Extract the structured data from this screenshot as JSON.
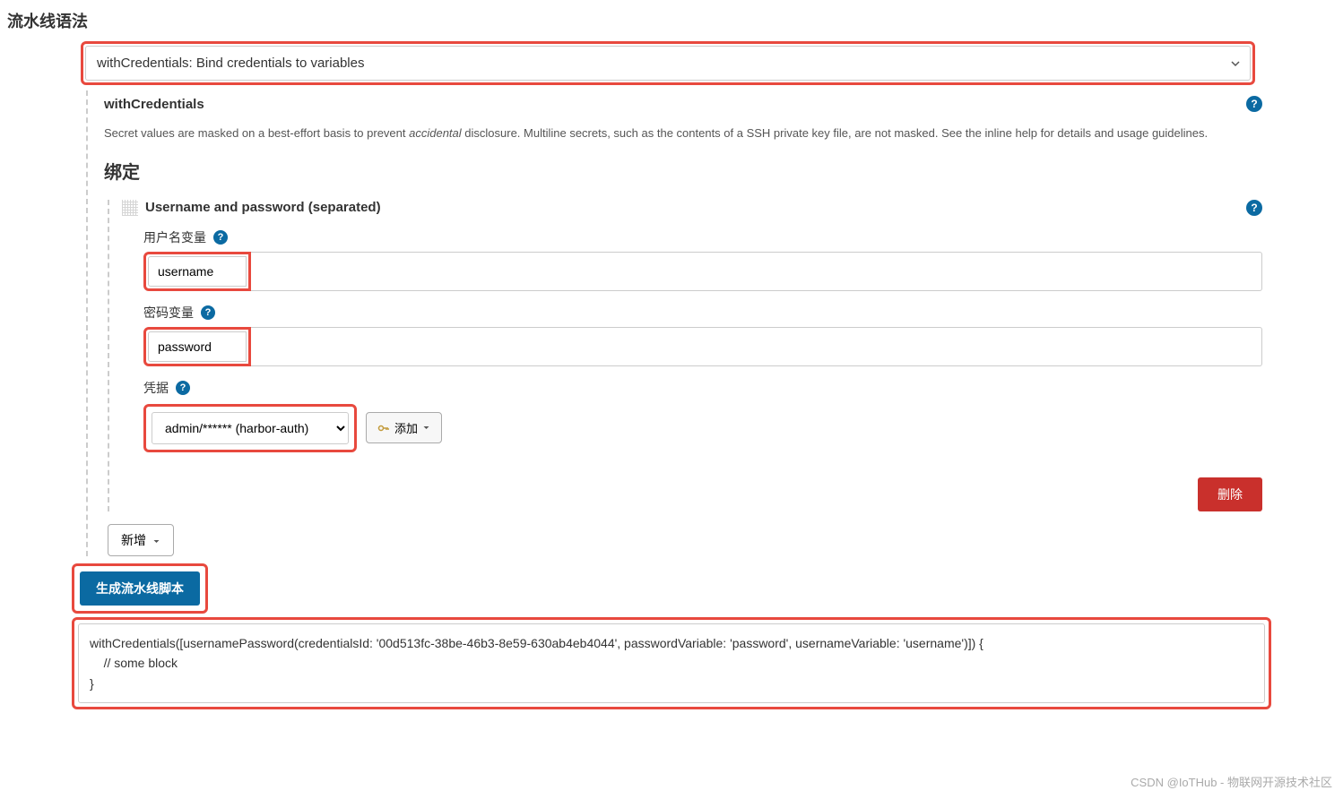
{
  "page_title": "流水线语法",
  "step_select": {
    "selected": "withCredentials: Bind credentials to variables"
  },
  "with_credentials": {
    "heading": "withCredentials",
    "description_prefix": "Secret values are masked on a best-effort basis to prevent ",
    "description_em": "accidental",
    "description_suffix": " disclosure. Multiline secrets, such as the contents of a SSH private key file, are not masked. See the inline help for details and usage guidelines."
  },
  "bindings": {
    "title": "绑定",
    "binding_type": "Username and password (separated)",
    "username_var_label": "用户名变量",
    "username_var_value": "username",
    "password_var_label": "密码变量",
    "password_var_value": "password",
    "credentials_label": "凭据",
    "credentials_selected": "admin/****** (harbor-auth)",
    "add_label": "添加",
    "delete_label": "删除",
    "new_label": "新增"
  },
  "generate": {
    "button": "生成流水线脚本",
    "output": "withCredentials([usernamePassword(credentialsId: '00d513fc-38be-46b3-8e59-630ab4eb4044', passwordVariable: 'password', usernameVariable: 'username')]) {\n    // some block\n}"
  },
  "watermark": "CSDN @IoTHub - 物联网开源技术社区"
}
